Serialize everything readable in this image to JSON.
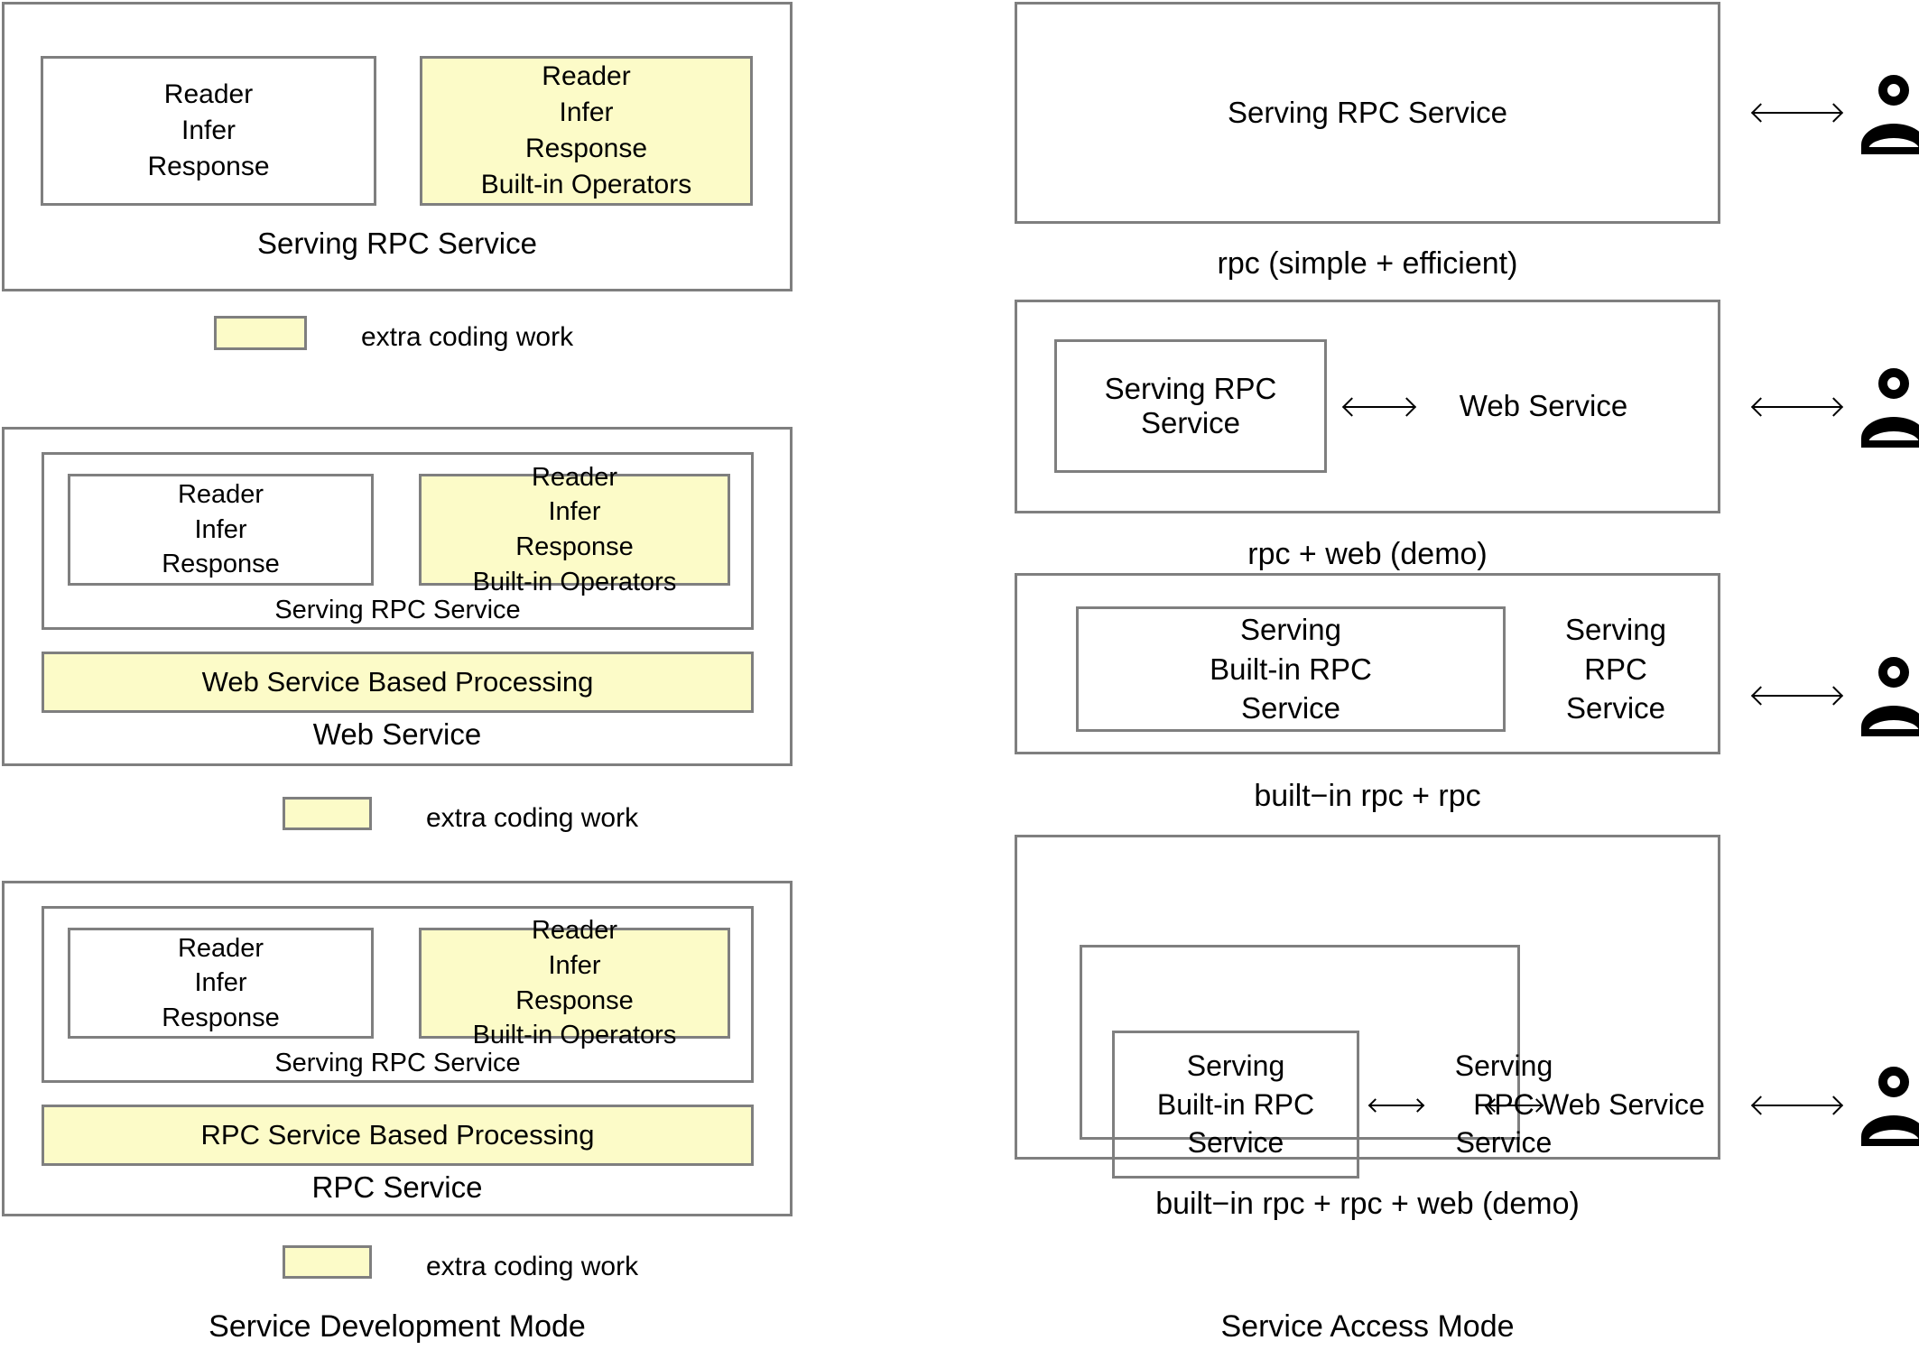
{
  "left_column": {
    "caption": "Service Development Mode",
    "legend_label": "extra coding work",
    "panels": [
      {
        "id": "panel-rpc-only",
        "outer_label": "Serving RPC Service",
        "plain_block": "Reader\nInfer\nResponse",
        "yellow_block": "Reader\nInfer\nResponse\nBuilt-in Operators",
        "legend_label": "extra coding work"
      },
      {
        "id": "panel-web-service",
        "outer_label": "Web Service",
        "mid_label": "Serving RPC Service",
        "plain_block": "Reader\nInfer\nResponse",
        "yellow_block": "Reader\nInfer\nResponse\nBuilt-in Operators",
        "yellow_bar": "Web Service Based Processing",
        "legend_label": "extra coding work"
      },
      {
        "id": "panel-rpc-service",
        "outer_label": "RPC Service",
        "mid_label": "Serving RPC Service",
        "plain_block": "Reader\nInfer\nResponse",
        "yellow_block": "Reader\nInfer\nResponse\nBuilt-in Operators",
        "yellow_bar": "RPC Service Based Processing",
        "legend_label": "extra coding work"
      }
    ]
  },
  "right_column": {
    "caption": "Service Access Mode",
    "panels": [
      {
        "id": "access-rpc",
        "caption": "rpc (simple + efficient)",
        "labels": [
          "Serving RPC Service"
        ]
      },
      {
        "id": "access-rpc-web",
        "caption": "rpc + web (demo)",
        "inner_label": "Serving RPC Service",
        "outer_right_label": "Web Service"
      },
      {
        "id": "access-builtin-rpc",
        "caption": "built−in rpc + rpc",
        "inner_label": "Serving\nBuilt-in RPC\nService",
        "outer_right_label": "Serving\nRPC\nService"
      },
      {
        "id": "access-builtin-rpc-web",
        "caption": "built−in rpc + rpc + web (demo)",
        "innermost_label": "Serving\nBuilt-in RPC\nService",
        "middle_label": "Serving\nRPC\nService",
        "outer_right_label": "Web Service"
      }
    ],
    "user_icon_name": "user-icon"
  },
  "colors": {
    "highlight": "#fcfbc8",
    "border": "#7f7f7f",
    "text": "#000000"
  }
}
